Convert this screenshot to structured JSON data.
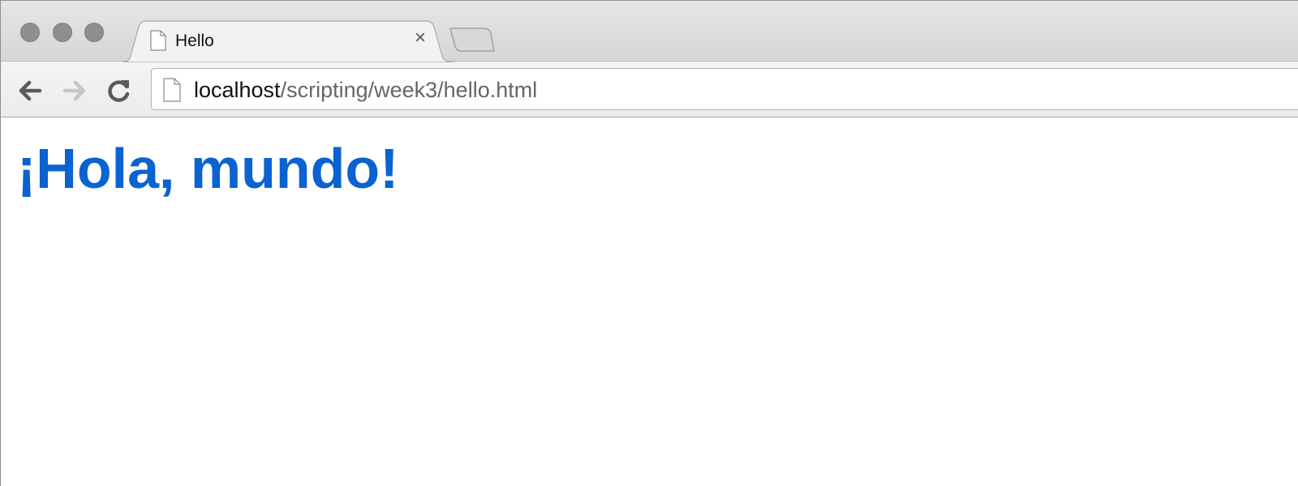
{
  "window": {
    "traffic_lights": [
      "close-window-button",
      "minimize-window-button",
      "zoom-window-button"
    ]
  },
  "tab": {
    "title": "Hello",
    "close_label": "×"
  },
  "toolbar": {
    "url_host": "localhost",
    "url_path": "/scripting/week3/hello.html"
  },
  "page": {
    "heading": "¡Hola, mundo!"
  },
  "colors": {
    "heading": "#0a63d0",
    "traffic_light": "#8f8f93"
  }
}
